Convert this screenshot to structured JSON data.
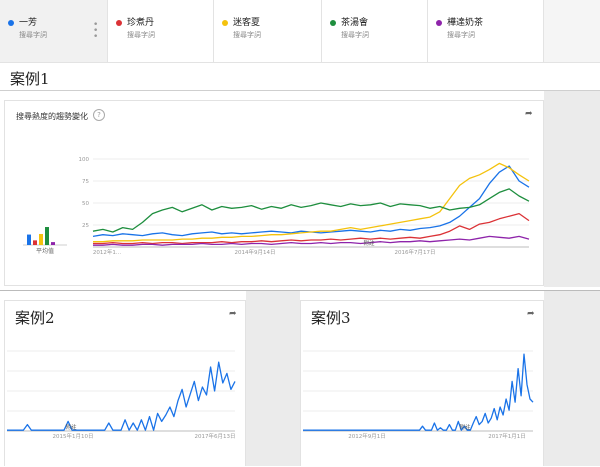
{
  "terms": [
    {
      "name": "一芳",
      "sub": "搜尋字詞",
      "color": "#1a73e8"
    },
    {
      "name": "珍煮丹",
      "sub": "搜尋字詞",
      "color": "#db3236"
    },
    {
      "name": "迷客夏",
      "sub": "搜尋字詞",
      "color": "#f4c20d"
    },
    {
      "name": "茶湯會",
      "sub": "搜尋字詞",
      "color": "#1e8e3e"
    },
    {
      "name": "樺達奶茶",
      "sub": "搜尋字詞",
      "color": "#8e24aa"
    }
  ],
  "case1": {
    "heading": "案例1",
    "card_title": "搜尋熱度的趨勢變化",
    "avg_label": "平均值"
  },
  "case2": {
    "heading": "案例2"
  },
  "case3": {
    "heading": "案例3"
  },
  "chart_data": [
    {
      "type": "bar",
      "categories": [
        "一芳",
        "珍煮丹",
        "迷客夏",
        "茶湯會",
        "樺達奶茶"
      ],
      "values": [
        18,
        8,
        19,
        31,
        5
      ],
      "xlabel": "平均值",
      "ylim": [
        0,
        100
      ],
      "colors": [
        "#1a73e8",
        "#db3236",
        "#f4c20d",
        "#1e8e3e",
        "#8e24aa"
      ]
    },
    {
      "type": "line",
      "yticks": [
        25,
        50,
        75,
        100
      ],
      "ylim": [
        0,
        100
      ],
      "xtick_labels": [
        "2012年1...",
        "2014年9月14日",
        "2016年7月17日"
      ],
      "annotation": "附註",
      "series": [
        {
          "name": "一芳",
          "color": "#1a73e8",
          "values": [
            12,
            14,
            13,
            15,
            14,
            13,
            15,
            16,
            14,
            13,
            15,
            16,
            17,
            15,
            16,
            15,
            16,
            17,
            18,
            17,
            16,
            18,
            17,
            16,
            17,
            18,
            19,
            18,
            17,
            19,
            18,
            20,
            19,
            21,
            22,
            24,
            28,
            35,
            45,
            55,
            72,
            85,
            92,
            75,
            68
          ]
        },
        {
          "name": "珍煮丹",
          "color": "#db3236",
          "values": [
            4,
            4,
            5,
            4,
            4,
            5,
            4,
            5,
            5,
            4,
            5,
            5,
            5,
            6,
            5,
            6,
            6,
            7,
            6,
            7,
            8,
            7,
            8,
            8,
            9,
            8,
            9,
            10,
            9,
            10,
            9,
            10,
            11,
            10,
            12,
            14,
            18,
            24,
            20,
            26,
            28,
            32,
            35,
            38,
            30
          ]
        },
        {
          "name": "迷客夏",
          "color": "#f4c20d",
          "values": [
            6,
            6,
            7,
            7,
            7,
            8,
            8,
            8,
            8,
            9,
            9,
            10,
            10,
            11,
            11,
            12,
            12,
            13,
            14,
            14,
            15,
            16,
            17,
            18,
            18,
            20,
            22,
            20,
            22,
            24,
            26,
            28,
            30,
            32,
            34,
            40,
            55,
            70,
            78,
            82,
            88,
            95,
            90,
            82,
            75
          ]
        },
        {
          "name": "茶湯會",
          "color": "#1e8e3e",
          "values": [
            18,
            20,
            17,
            22,
            20,
            28,
            38,
            42,
            45,
            40,
            44,
            48,
            42,
            46,
            44,
            45,
            47,
            43,
            46,
            44,
            48,
            45,
            47,
            50,
            48,
            46,
            49,
            47,
            48,
            50,
            46,
            49,
            48,
            47,
            44,
            46,
            42,
            44,
            45,
            48,
            55,
            62,
            66,
            58,
            52
          ]
        },
        {
          "name": "樺達奶茶",
          "color": "#8e24aa",
          "values": [
            2,
            2,
            3,
            2,
            2,
            3,
            3,
            2,
            3,
            3,
            3,
            4,
            3,
            3,
            4,
            3,
            4,
            4,
            3,
            4,
            5,
            4,
            4,
            5,
            4,
            5,
            5,
            4,
            5,
            6,
            5,
            6,
            6,
            7,
            6,
            7,
            8,
            9,
            8,
            10,
            12,
            11,
            10,
            12,
            9
          ]
        }
      ]
    },
    {
      "type": "line",
      "xtick_labels": [
        "2015年1月10日",
        "2017年6月13日"
      ],
      "annotation": "附註",
      "series": [
        {
          "name": "",
          "color": "#1a73e8",
          "values": [
            1,
            1,
            1,
            1,
            1,
            8,
            1,
            1,
            1,
            1,
            1,
            1,
            1,
            1,
            1,
            12,
            1,
            1,
            1,
            1,
            1,
            1,
            1,
            1,
            1,
            10,
            1,
            1,
            1,
            14,
            1,
            10,
            1,
            14,
            1,
            18,
            1,
            22,
            12,
            20,
            30,
            18,
            38,
            52,
            30,
            46,
            62,
            38,
            55,
            45,
            80,
            50,
            86,
            60,
            72,
            52,
            62
          ]
        }
      ]
    },
    {
      "type": "line",
      "xtick_labels": [
        "2012年9月1日",
        "2017年1月1日"
      ],
      "annotation": "附註",
      "series": [
        {
          "name": "",
          "color": "#1a73e8",
          "values": [
            1,
            1,
            1,
            1,
            1,
            1,
            1,
            1,
            1,
            1,
            1,
            1,
            1,
            1,
            1,
            1,
            1,
            1,
            1,
            1,
            1,
            1,
            1,
            1,
            1,
            1,
            1,
            1,
            1,
            1,
            1,
            1,
            1,
            1,
            1,
            1,
            1,
            1,
            1,
            1,
            6,
            1,
            1,
            1,
            10,
            1,
            4,
            1,
            1,
            8,
            1,
            1,
            12,
            1,
            6,
            1,
            1,
            10,
            18,
            8,
            12,
            22,
            10,
            16,
            28,
            14,
            30,
            20,
            40,
            26,
            62,
            36,
            78,
            44,
            96,
            58,
            40,
            36
          ]
        }
      ]
    }
  ]
}
